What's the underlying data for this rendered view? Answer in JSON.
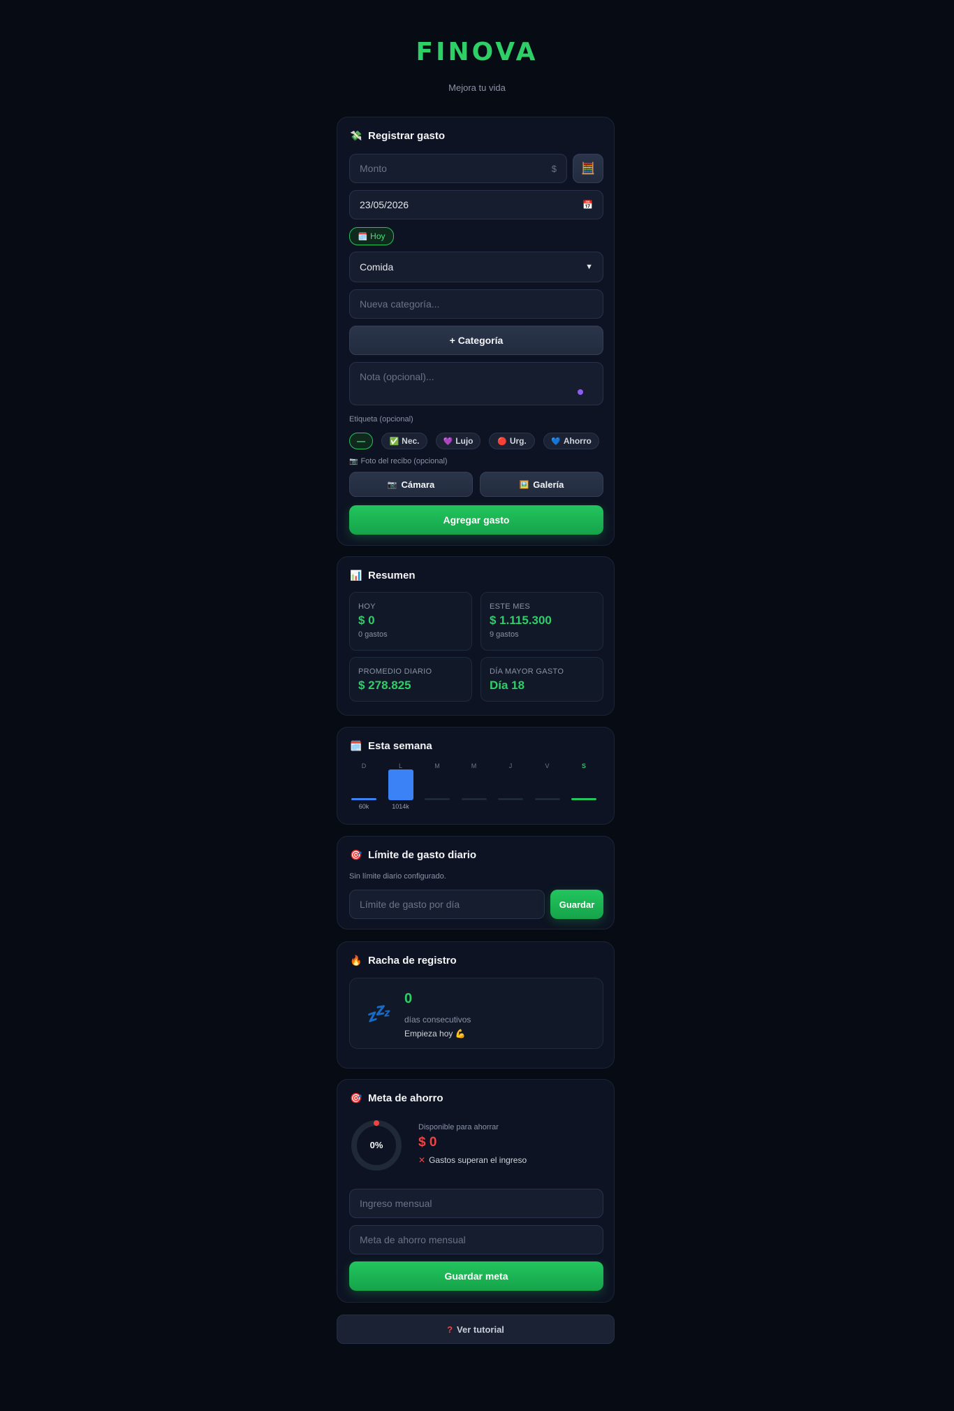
{
  "brand": {
    "name": "FINOVA",
    "tagline": "Mejora tu vida"
  },
  "expense": {
    "title": "Registrar gasto",
    "amount_placeholder": "Monto",
    "currency_symbol": "$",
    "date_value": "23/05/2026",
    "today_label": "Hoy",
    "category_value": "Comida",
    "new_category_placeholder": "Nueva categoría...",
    "add_category_label": "+ Categoría",
    "note_placeholder": "Nota (opcional)...",
    "tag_label": "Etiqueta (opcional)",
    "tags": [
      {
        "label": "—",
        "icon": ""
      },
      {
        "label": "Nec.",
        "icon": "✅"
      },
      {
        "label": "Lujo",
        "icon": "💜"
      },
      {
        "label": "Urg.",
        "icon": "🔴"
      },
      {
        "label": "Ahorro",
        "icon": "💙"
      }
    ],
    "receipt_label": "Foto del recibo (opcional)",
    "camera_label": "Cámara",
    "gallery_label": "Galería",
    "submit_label": "Agregar gasto"
  },
  "summary": {
    "title": "Resumen",
    "today": {
      "label": "HOY",
      "value": "$ 0",
      "sub": "0 gastos"
    },
    "month": {
      "label": "ESTE MES",
      "value": "$ 1.115.300",
      "sub": "9 gastos"
    },
    "daily_avg": {
      "label": "PROMEDIO DIARIO",
      "value": "$ 278.825"
    },
    "max_day": {
      "label": "DÍA MAYOR GASTO",
      "value": "Día 18"
    }
  },
  "week": {
    "title": "Esta semana",
    "days": [
      {
        "label": "D",
        "value_k": 60,
        "text": "60k"
      },
      {
        "label": "L",
        "value_k": 1014,
        "text": "1014k"
      },
      {
        "label": "M",
        "value_k": 0,
        "text": ""
      },
      {
        "label": "M",
        "value_k": 0,
        "text": ""
      },
      {
        "label": "J",
        "value_k": 0,
        "text": ""
      },
      {
        "label": "V",
        "value_k": 0,
        "text": ""
      },
      {
        "label": "S",
        "value_k": 0,
        "text": "",
        "current": true
      }
    ],
    "colors": {
      "bar": "#3b82f6",
      "empty": "#1f2937",
      "current": "#22c55e"
    }
  },
  "limit": {
    "title": "Límite de gasto diario",
    "status": "Sin límite diario configurado.",
    "input_placeholder": "Límite de gasto por día",
    "save_label": "Guardar"
  },
  "streak": {
    "title": "Racha de registro",
    "count": "0",
    "unit": "días consecutivos",
    "message": "Empieza hoy 💪"
  },
  "savings": {
    "title": "Meta de ahorro",
    "percent": "0%",
    "available_label": "Disponible para ahorrar",
    "available_value": "$ 0",
    "warning": "Gastos superan el ingreso",
    "income_placeholder": "Ingreso mensual",
    "goal_placeholder": "Meta de ahorro mensual",
    "save_label": "Guardar meta"
  },
  "tutorial": {
    "label": "Ver tutorial"
  }
}
